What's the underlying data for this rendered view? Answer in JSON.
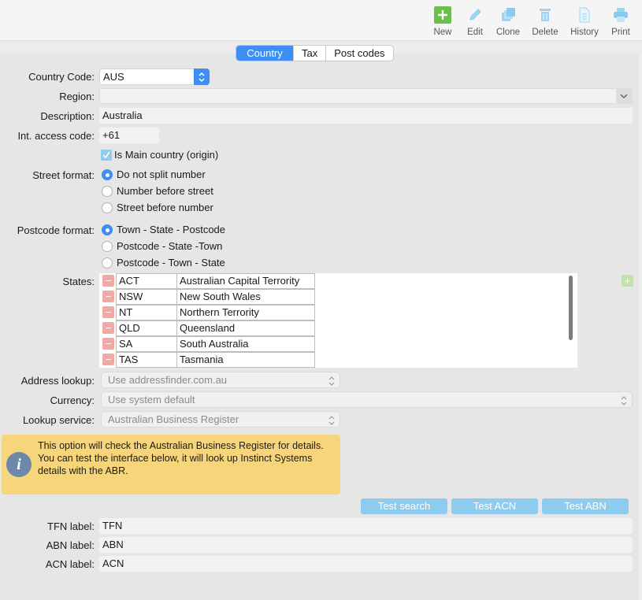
{
  "toolbar": {
    "new": "New",
    "edit": "Edit",
    "clone": "Clone",
    "delete": "Delete",
    "history": "History",
    "print": "Print"
  },
  "tabs": [
    "Country",
    "Tax",
    "Post codes"
  ],
  "form": {
    "country_code_label": "Country Code:",
    "country_code_value": "AUS",
    "region_label": "Region:",
    "region_value": "",
    "description_label": "Description:",
    "description_value": "Australia",
    "int_access_label": "Int. access code:",
    "int_access_value": "+61",
    "main_country_label": "Is Main country (origin)",
    "main_country_checked": true,
    "street_format_label": "Street format:",
    "street_options": [
      "Do not split number",
      "Number before street",
      "Street before number"
    ],
    "street_selected": 0,
    "postcode_format_label": "Postcode format:",
    "postcode_options": [
      "Town - State - Postcode",
      "Postcode - State -Town",
      "Postcode - Town - State"
    ],
    "postcode_selected": 0,
    "states_label": "States:",
    "states": [
      {
        "code": "ACT",
        "name": "Australian Capital Terrority"
      },
      {
        "code": "NSW",
        "name": "New South Wales"
      },
      {
        "code": "NT",
        "name": "Northern Terrority"
      },
      {
        "code": "QLD",
        "name": "Queensland"
      },
      {
        "code": "SA",
        "name": "South Australia"
      },
      {
        "code": "TAS",
        "name": "Tasmania"
      }
    ],
    "address_lookup_label": "Address lookup:",
    "address_lookup_value": "Use addressfinder.com.au",
    "currency_label": "Currency:",
    "currency_value": "Use system default",
    "lookup_service_label": "Lookup service:",
    "lookup_service_value": "Australian Business Register",
    "info_line1": "This option will check the Australian Business Register for details.",
    "info_line2": "You can test the interface below, it will look up Instinct Systems details with the ABR.",
    "test_search": "Test search",
    "test_acn": "Test ACN",
    "test_abn": "Test ABN",
    "tfn_label": "TFN label:",
    "tfn_value": "TFN",
    "abn_label": "ABN label:",
    "abn_value": "ABN",
    "acn_label": "ACN label:",
    "acn_value": "ACN"
  },
  "colors": {
    "accent": "#3d8ff5",
    "info_bg": "#f6d57c",
    "test_button": "#8dcbef",
    "remove_button": "#f2a9a4",
    "new_icon": "#6cbf4a"
  }
}
